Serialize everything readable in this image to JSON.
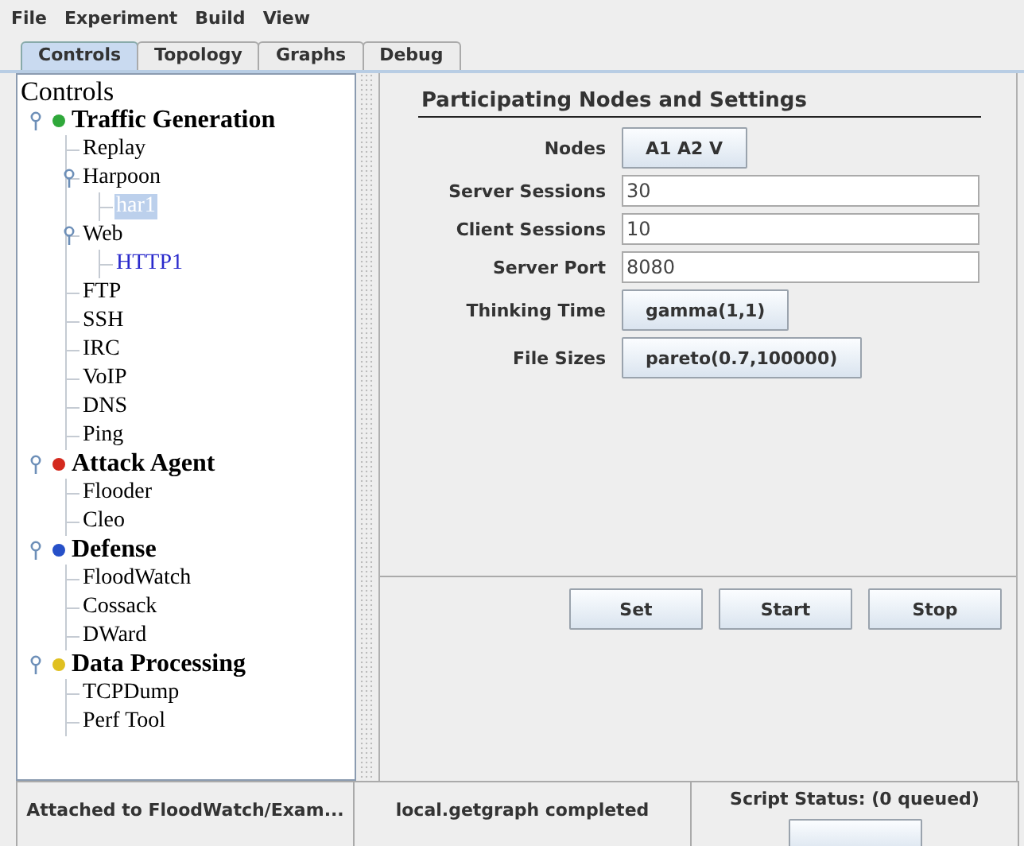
{
  "menu": [
    "File",
    "Experiment",
    "Build",
    "View"
  ],
  "tabs": [
    {
      "label": "Controls",
      "selected": true
    },
    {
      "label": "Topology",
      "selected": false
    },
    {
      "label": "Graphs",
      "selected": false
    },
    {
      "label": "Debug",
      "selected": false
    }
  ],
  "tree": {
    "title": "Controls",
    "groups": [
      {
        "label": "Traffic Generation",
        "color": "#2fa83a",
        "expanded": true,
        "children": [
          {
            "label": "Replay"
          },
          {
            "label": "Harpoon",
            "expanded": true,
            "children": [
              {
                "label": "har1",
                "selected": true,
                "highlighted": false
              }
            ]
          },
          {
            "label": "Web",
            "expanded": true,
            "children": [
              {
                "label": "HTTP1",
                "selected": false,
                "highlighted": true
              }
            ]
          },
          {
            "label": "FTP"
          },
          {
            "label": "SSH"
          },
          {
            "label": "IRC"
          },
          {
            "label": "VoIP"
          },
          {
            "label": "DNS"
          },
          {
            "label": "Ping"
          }
        ]
      },
      {
        "label": "Attack Agent",
        "color": "#d42a1e",
        "expanded": true,
        "children": [
          {
            "label": "Flooder"
          },
          {
            "label": "Cleo"
          }
        ]
      },
      {
        "label": "Defense",
        "color": "#2650c8",
        "expanded": true,
        "children": [
          {
            "label": "FloodWatch"
          },
          {
            "label": "Cossack"
          },
          {
            "label": "DWard"
          }
        ]
      },
      {
        "label": "Data Processing",
        "color": "#e0c020",
        "expanded": true,
        "children": [
          {
            "label": "TCPDump"
          },
          {
            "label": "Perf Tool"
          }
        ]
      }
    ]
  },
  "settings": {
    "title": "Participating Nodes and Settings",
    "rows": [
      {
        "kind": "button",
        "label": "Nodes",
        "value": "A1 A2 V"
      },
      {
        "kind": "field",
        "label": "Server Sessions",
        "value": "30"
      },
      {
        "kind": "field",
        "label": "Client Sessions",
        "value": "10"
      },
      {
        "kind": "field",
        "label": "Server Port",
        "value": "8080"
      },
      {
        "kind": "button",
        "label": "Thinking Time",
        "value": "gamma(1,1)"
      },
      {
        "kind": "button",
        "label": "File Sizes",
        "value": "pareto(0.7,100000)"
      }
    ]
  },
  "buttons": [
    "Set",
    "Start",
    "Stop"
  ],
  "status_bar": {
    "attached": "Attached to FloodWatch/Exam...",
    "message": "local.getgraph completed",
    "script_status": "Script Status:  (0 queued)"
  }
}
